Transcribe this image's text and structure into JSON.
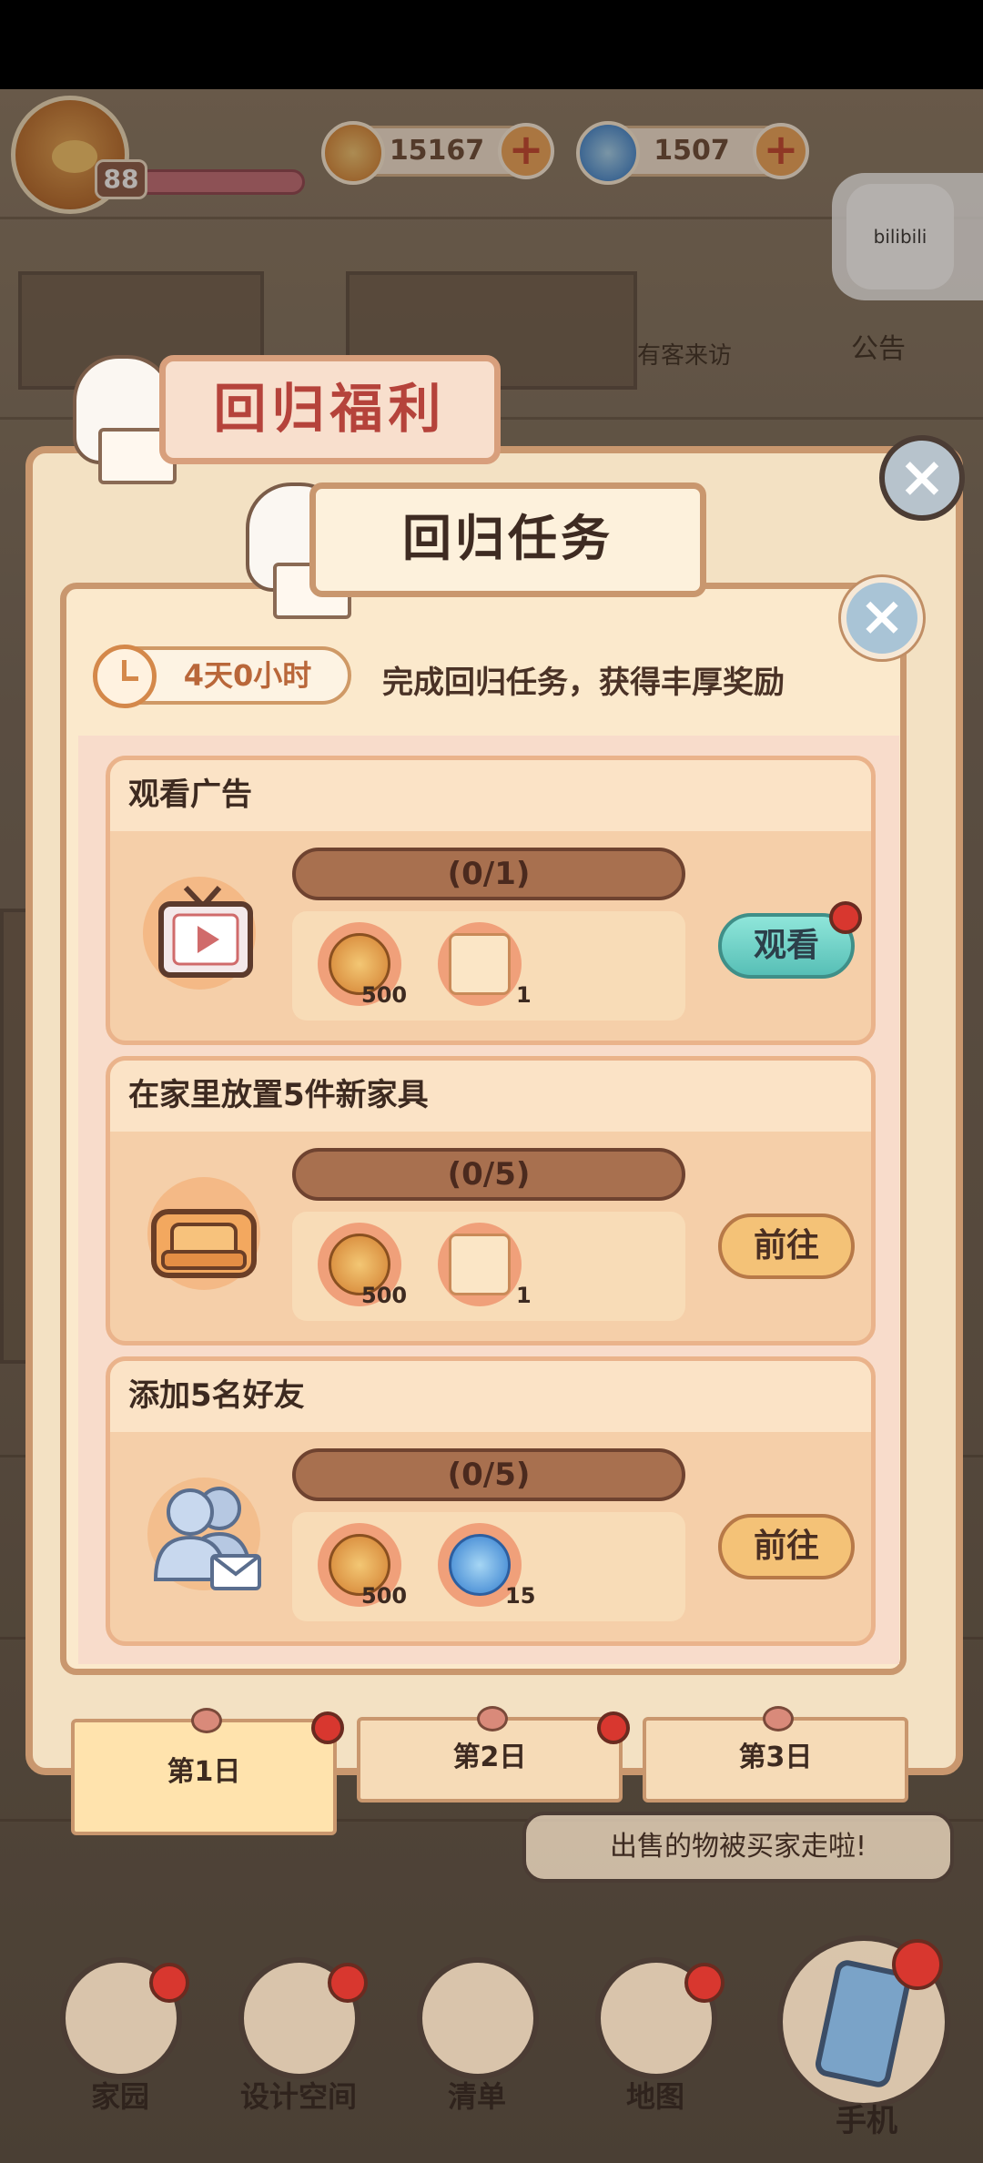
{
  "hud": {
    "level": "88",
    "coins": "15167",
    "gems": "1507",
    "plus": "+",
    "bili_logo": "bilibili",
    "notice_label": "公告",
    "visitor_label": "有客来访"
  },
  "outer": {
    "title": "回归福利",
    "close": "×"
  },
  "inner": {
    "title": "回归任务",
    "close": "×",
    "timer": "4天0小时",
    "subtitle": "完成回归任务，获得丰厚奖励"
  },
  "tasks": [
    {
      "title": "观看广告",
      "progress": "(0/1)",
      "icon": "tv-play-icon",
      "rewards": [
        {
          "icon": "coin-icon",
          "qty": "500"
        },
        {
          "icon": "paw-scroll-icon",
          "qty": "1"
        }
      ],
      "button": "观看",
      "badge": true
    },
    {
      "title": "在家里放置5件新家具",
      "progress": "(0/5)",
      "icon": "sofa-icon",
      "rewards": [
        {
          "icon": "coin-icon",
          "qty": "500"
        },
        {
          "icon": "paw-scroll-icon",
          "qty": "1"
        }
      ],
      "button": "前往",
      "badge": false
    },
    {
      "title": "添加5名好友",
      "progress": "(0/5)",
      "icon": "friends-icon",
      "rewards": [
        {
          "icon": "coin-icon",
          "qty": "500"
        },
        {
          "icon": "swirl-gem-icon",
          "qty": "15"
        }
      ],
      "button": "前往",
      "badge": false
    }
  ],
  "days": [
    {
      "label": "第1日",
      "active": true,
      "badge": true
    },
    {
      "label": "第2日",
      "active": false,
      "badge": true
    },
    {
      "label": "第3日",
      "active": false,
      "badge": false
    }
  ],
  "toast": "出售的物被买家走啦!",
  "nav": {
    "home": "家园",
    "design": "设计空间",
    "list": "清单",
    "map": "地图",
    "phone": "手机"
  },
  "colors": {
    "accent_red": "#d8372f",
    "coin_gold": "#e6a452",
    "gem_blue": "#4a8fd6",
    "panel_cream": "#fbe9cc",
    "title_red": "#b5433b"
  }
}
